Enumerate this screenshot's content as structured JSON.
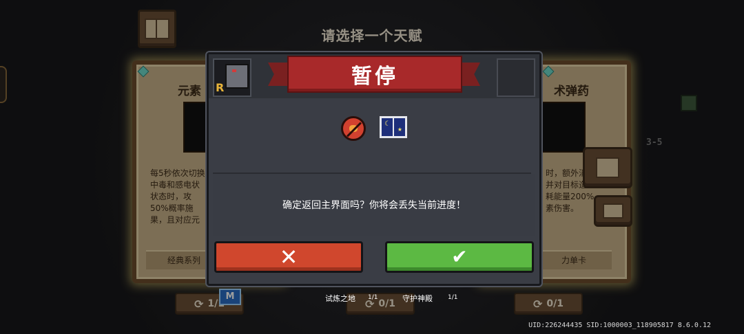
{
  "screen_title": "请选择一个天赋",
  "pause": {
    "title": "暂停",
    "character_rank": "R",
    "confirm_message": "确定返回主界面吗？你将会丢失当前进度！",
    "cancel_symbol": "✕",
    "confirm_symbol": "✔"
  },
  "cards": {
    "left": {
      "title_partial": "元素",
      "desc_lines": [
        "每5秒依次切换",
        "中毒和感电状",
        "状态时，攻",
        "50%概率施",
        "果，且对应元"
      ],
      "footer": "经典系列"
    },
    "right": {
      "title_partial": "术弹药",
      "desc_lines": [
        "时，额外消",
        "并对目标造",
        "耗能量200%",
        "素伤害。"
      ],
      "footer": "力单卡"
    }
  },
  "level_label": "3-5",
  "bottom": {
    "refresh_left": "1/1",
    "refresh_mid": "0/1",
    "refresh_right": "0/1",
    "m_badge": "M",
    "trial_label": "试炼之地",
    "trial_count": "1/1",
    "guard_label": "守护神殿",
    "guard_count": "1/1"
  },
  "uid_text": "UID:226244435 SID:1000003_118905817 8.6.0.12"
}
